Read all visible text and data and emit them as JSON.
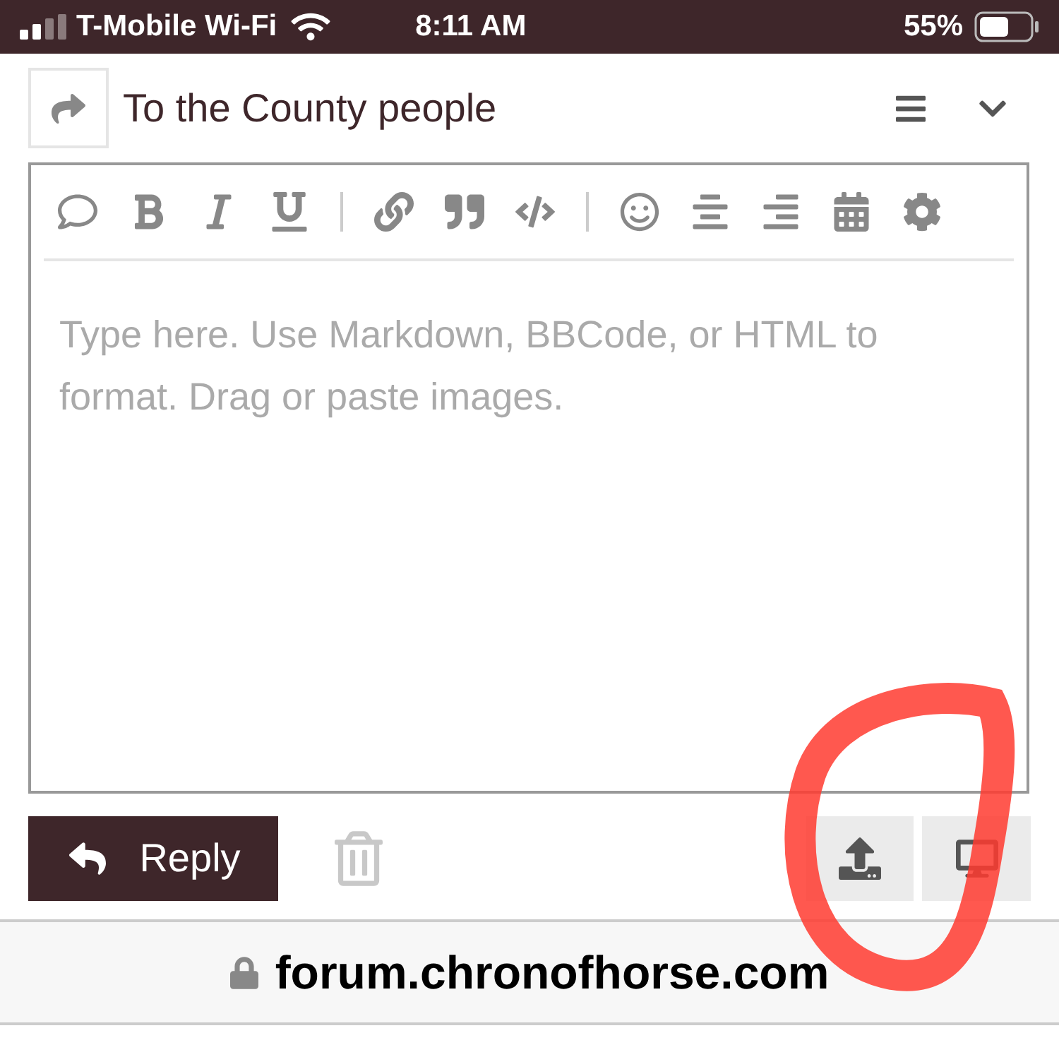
{
  "status_bar": {
    "carrier": "T-Mobile Wi-Fi",
    "time": "8:11 AM",
    "battery": "55%"
  },
  "thread": {
    "title": "To the County people"
  },
  "editor": {
    "placeholder": "Type here. Use Markdown, BBCode, or HTML to format. Drag or paste images."
  },
  "actions": {
    "reply": "Reply"
  },
  "address_bar": {
    "url": "forum.chronofhorse.com"
  }
}
